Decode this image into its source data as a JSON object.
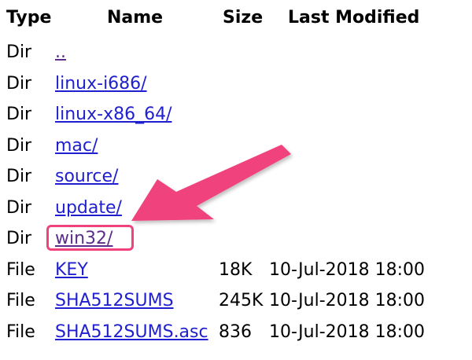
{
  "header": {
    "type": "Type",
    "name": "Name",
    "size": "Size",
    "last_modified": "Last Modified"
  },
  "rows": [
    {
      "type": "Dir",
      "name": "..",
      "size": "",
      "modified": ""
    },
    {
      "type": "Dir",
      "name": "linux-i686/",
      "size": "",
      "modified": ""
    },
    {
      "type": "Dir",
      "name": "linux-x86_64/",
      "size": "",
      "modified": ""
    },
    {
      "type": "Dir",
      "name": "mac/",
      "size": "",
      "modified": ""
    },
    {
      "type": "Dir",
      "name": "source/",
      "size": "",
      "modified": ""
    },
    {
      "type": "Dir",
      "name": "update/",
      "size": "",
      "modified": ""
    },
    {
      "type": "Dir",
      "name": "win32/",
      "size": "",
      "modified": ""
    },
    {
      "type": "File",
      "name": "KEY",
      "size": "18K",
      "modified": "10-Jul-2018 18:00"
    },
    {
      "type": "File",
      "name": "SHA512SUMS",
      "size": "245K",
      "modified": "10-Jul-2018 18:00"
    },
    {
      "type": "File",
      "name": "SHA512SUMS.asc",
      "size": "836",
      "modified": "10-Jul-2018 18:00"
    }
  ],
  "annotation": {
    "highlighted_item": "win32/",
    "color": "#f0437c"
  },
  "colors": {
    "link": "#1f1fd0",
    "visited_link": "#5a2d8a"
  }
}
